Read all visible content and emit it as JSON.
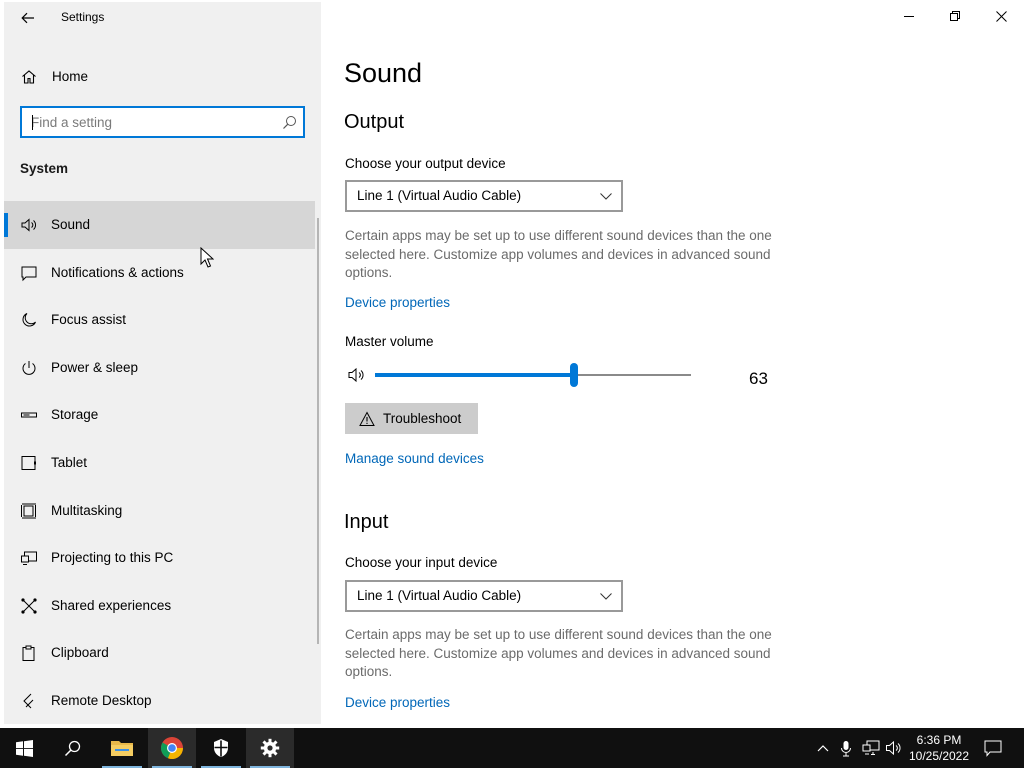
{
  "app": {
    "title": "Settings"
  },
  "sidebar": {
    "home_label": "Home",
    "search_placeholder": "Find a setting",
    "section": "System",
    "items": [
      {
        "label": "Sound",
        "icon": "speaker-icon",
        "active": true
      },
      {
        "label": "Notifications & actions",
        "icon": "message-icon"
      },
      {
        "label": "Focus assist",
        "icon": "moon-icon"
      },
      {
        "label": "Power & sleep",
        "icon": "power-icon"
      },
      {
        "label": "Storage",
        "icon": "storage-icon"
      },
      {
        "label": "Tablet",
        "icon": "tablet-icon"
      },
      {
        "label": "Multitasking",
        "icon": "multitasking-icon"
      },
      {
        "label": "Projecting to this PC",
        "icon": "projecting-icon"
      },
      {
        "label": "Shared experiences",
        "icon": "shared-experiences-icon"
      },
      {
        "label": "Clipboard",
        "icon": "clipboard-icon"
      },
      {
        "label": "Remote Desktop",
        "icon": "remote-desktop-icon"
      }
    ]
  },
  "main": {
    "page_title": "Sound",
    "output": {
      "heading": "Output",
      "device_label": "Choose your output device",
      "device_value": "Line 1 (Virtual Audio Cable)",
      "description": "Certain apps may be set up to use different sound devices than the one selected here. Customize app volumes and devices in advanced sound options.",
      "device_properties": "Device properties",
      "master_volume_label": "Master volume",
      "master_volume": 63,
      "master_volume_text": "63",
      "troubleshoot": "Troubleshoot",
      "manage_devices": "Manage sound devices"
    },
    "input": {
      "heading": "Input",
      "device_label": "Choose your input device",
      "device_value": "Line 1 (Virtual Audio Cable)",
      "description": "Certain apps may be set up to use different sound devices than the one selected here. Customize app volumes and devices in advanced sound options.",
      "device_properties": "Device properties"
    }
  },
  "taskbar": {
    "apps": [
      "start-icon",
      "search-icon",
      "file-explorer-icon",
      "chrome-icon",
      "security-icon",
      "settings-icon"
    ],
    "time": "6:36 PM",
    "date": "10/25/2022"
  },
  "colors": {
    "accent": "#0078d7",
    "link": "#0067b8",
    "sidebar_bg": "#f0f0f0",
    "taskbar_bg": "#101010"
  }
}
